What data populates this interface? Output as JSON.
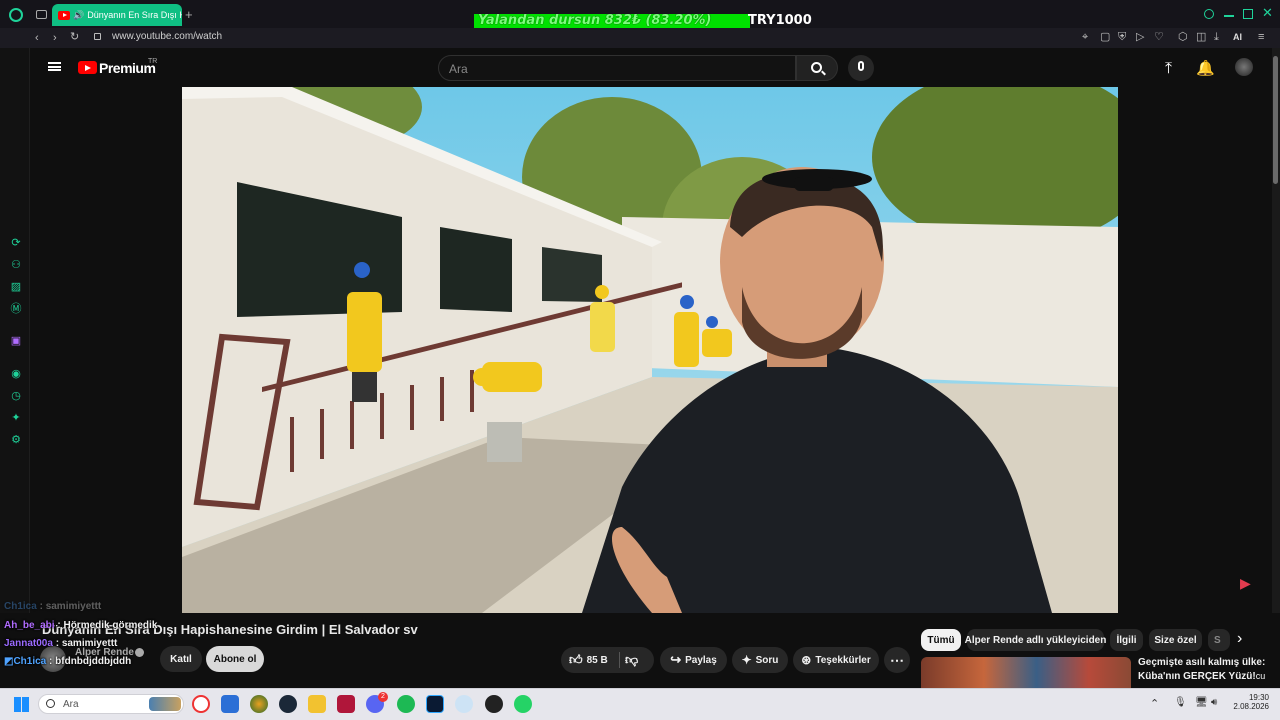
{
  "browser": {
    "tab_title": "Dünyanın En Sıra Dışı H",
    "url": "www.youtube.com/watch",
    "ai_label": "AI"
  },
  "overlay": {
    "text": "Yalandan dursun  832₺ (83.20%)",
    "currency": "TRY1000",
    "progress": 0.832,
    "color": "#00e000"
  },
  "youtube": {
    "logo_text": "Premium",
    "logo_region": "TR",
    "search_placeholder": "Ara"
  },
  "video": {
    "title": "Dünyanın En Sıra Dışı Hapishanesine Girdim | El Salvador sv",
    "channel": "Alper Rende",
    "join_label": "Katıl",
    "subscribe_label": "Abone ol",
    "likes": "85 B",
    "share_label": "Paylaş",
    "ask_label": "Soru",
    "thanks_label": "Teşekkürler"
  },
  "chips": [
    "Tümü",
    "Alper Rende adlı yükleyiciden",
    "İlgili",
    "Size özel",
    "S"
  ],
  "recommendation": {
    "title_line1": "Geçmişte asılı kalmış ülke:",
    "title_line2": "Küba'nın GERÇEK Yüzü!",
    "title_cut": "cu"
  },
  "chat": [
    {
      "user": "Ch1ica",
      "message": "samimiyettt",
      "color": "#4fa3ff"
    },
    {
      "user": "Ah_be_abi",
      "message": "Hörmedik görmedik",
      "color": "#b06cff"
    },
    {
      "user": "Jannat00a",
      "message": "samimiyettt",
      "color": "#9b6bff"
    },
    {
      "user": "Ch1ica",
      "message": "bfdnbdjddbjddh",
      "color": "#4fa3ff"
    }
  ],
  "taskbar": {
    "search_placeholder": "Ara",
    "time": "19:30",
    "date": "2.08.2026",
    "discord_badge": "2"
  }
}
